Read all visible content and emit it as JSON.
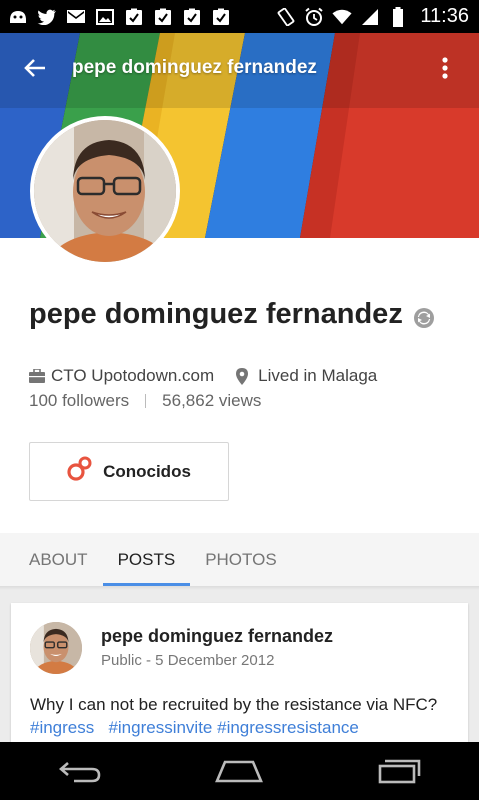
{
  "status_bar": {
    "time": "11:36",
    "left_icons": [
      "cat-icon",
      "twitter-icon",
      "gmail-icon",
      "image-icon",
      "clipboard-check-icon",
      "clipboard-check-icon",
      "clipboard-check-icon",
      "clipboard-check-icon"
    ],
    "right_icons": [
      "screen-rotation-icon",
      "alarm-icon",
      "wifi-icon",
      "signal-icon",
      "battery-icon"
    ]
  },
  "app_bar": {
    "title": "pepe dominguez fernandez",
    "back_icon": "arrow-back-icon",
    "menu_icon": "overflow-menu-icon"
  },
  "profile": {
    "name": "pepe dominguez fernandez",
    "badge_icon": "sync-icon",
    "work": "CTO Upotodown.com",
    "location": "Lived in Malaga",
    "followers": "100 followers",
    "views": "56,862 views",
    "circle_button": {
      "label": "Conocidos",
      "icon": "circles-icon",
      "color": "#e8543f"
    }
  },
  "tabs": [
    {
      "label": "ABOUT",
      "active": false
    },
    {
      "label": "POSTS",
      "active": true
    },
    {
      "label": "PHOTOS",
      "active": false
    }
  ],
  "post": {
    "author": "pepe dominguez fernandez",
    "meta": "Public - 5 December 2012",
    "text_main": "Why I can not be recruited by the resistance via NFC?",
    "tags": [
      "#ingress",
      "#ingressinvite",
      "#ingressresistance"
    ]
  },
  "nav_bar": [
    "back-nav-icon",
    "home-nav-icon",
    "recents-nav-icon"
  ],
  "colors": {
    "accent": "#4a8ee6",
    "hashtag": "#3f7fd8",
    "circle_red": "#e8543f"
  }
}
